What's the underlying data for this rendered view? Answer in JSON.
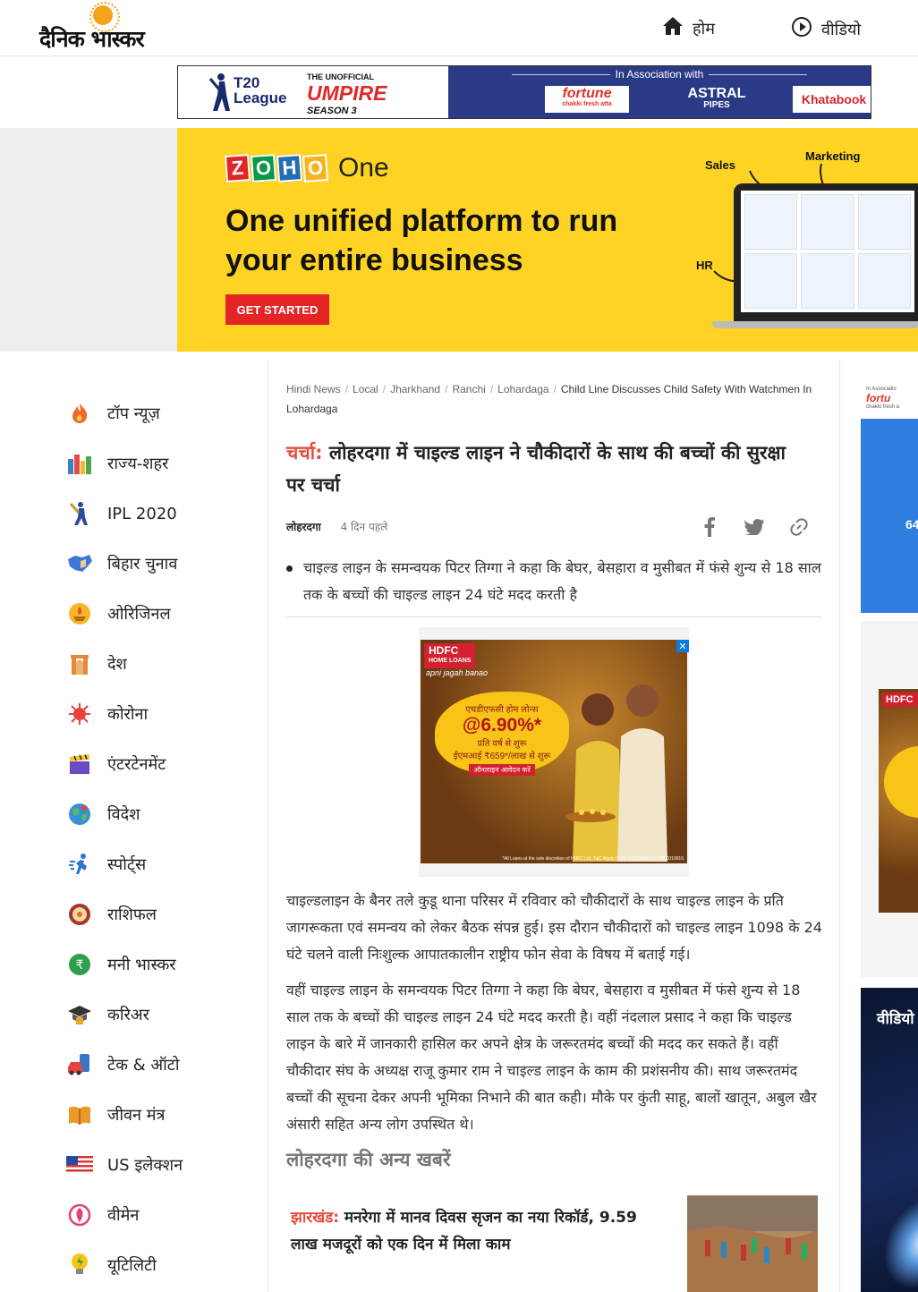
{
  "header": {
    "logo_text": "दैनिक भास्कर",
    "nav": [
      {
        "label": "होम",
        "icon": "home-icon"
      },
      {
        "label": "वीडियो",
        "icon": "play-circle-icon"
      }
    ]
  },
  "t20_banner": {
    "league": "T20\nLeague",
    "unofficial": "THE UNOFFICIAL",
    "umpire": "UMPIRE",
    "season": "SEASON 3",
    "association": "In Association with",
    "sponsors": [
      {
        "name": "fortune",
        "sub": "chakki fresh atta"
      },
      {
        "name": "ASTRAL",
        "sub": "PIPES"
      },
      {
        "name": "Khatabook"
      }
    ]
  },
  "zoho_ad": {
    "logo_letters": [
      "Z",
      "O",
      "H",
      "O"
    ],
    "logo_colors": [
      "#e42527",
      "#089949",
      "#226db4",
      "#f9b21d"
    ],
    "product": "One",
    "headline": "One unified platform to run your entire business",
    "cta": "GET STARTED",
    "labels": [
      "Sales",
      "Marketing",
      "HR"
    ]
  },
  "sidebar": {
    "items": [
      {
        "label": "टॉप न्यूज़",
        "icon": "fire-icon"
      },
      {
        "label": "राज्य-शहर",
        "icon": "city-icon"
      },
      {
        "label": "IPL 2020",
        "icon": "cricket-icon"
      },
      {
        "label": "बिहार चुनाव",
        "icon": "bihar-map-icon"
      },
      {
        "label": "ओरिजिनल",
        "icon": "lamp-icon"
      },
      {
        "label": "देश",
        "icon": "india-gate-icon"
      },
      {
        "label": "कोरोना",
        "icon": "virus-icon"
      },
      {
        "label": "एंटरटेनमेंट",
        "icon": "clapperboard-icon"
      },
      {
        "label": "विदेश",
        "icon": "globe-icon"
      },
      {
        "label": "स्पोर्ट्स",
        "icon": "runner-icon"
      },
      {
        "label": "राशिफल",
        "icon": "zodiac-icon"
      },
      {
        "label": "मनी भास्कर",
        "icon": "rupee-icon"
      },
      {
        "label": "करिअर",
        "icon": "graduation-cap-icon"
      },
      {
        "label": "टेक & ऑटो",
        "icon": "car-phone-icon"
      },
      {
        "label": "जीवन मंत्र",
        "icon": "book-icon"
      },
      {
        "label": "US इलेक्शन",
        "icon": "us-flag-icon"
      },
      {
        "label": "वीमेन",
        "icon": "women-icon"
      },
      {
        "label": "यूटिलिटी",
        "icon": "bulb-icon"
      }
    ]
  },
  "breadcrumb": {
    "items": [
      "Hindi News",
      "Local",
      "Jharkhand",
      "Ranchi",
      "Lohardaga"
    ],
    "current": "Child Line Discusses Child Safety With Watchmen In Lohardaga"
  },
  "article": {
    "kicker": "चर्चा:",
    "title": " लोहरदगा में चाइल्ड लाइन ने चौकीदारों के साथ की बच्चों की सुरक्षा पर चर्चा",
    "location": "लोहरदगा",
    "time": "4 दिन पहले",
    "summary": "चाइल्ड लाइन के समन्वयक पिटर तिग्गा ने कहा कि बेघर, बेसहारा व मुसीबत में फंसे शुन्य से 18 साल तक के बच्चों की चाइल्ड लाइन 24 घंटे मदद करती है",
    "para1": "चाइल्डलाइन के बैनर तले कुडू थाना परिसर में रविवार को चौकीदारों के साथ चाइल्ड लाइन के प्रति जागरूकता एवं समन्वय को लेकर बैठक संपन्न हुई। इस दौरान चौकीदारों को चाइल्ड लाइन 1098 के 24 घंटे चलने वाली निःशुल्क आपातकालीन राष्ट्रीय फोन सेवा के विषय में बताई गई।",
    "para2": "वहीं चाइल्ड लाइन के समन्वयक पिटर तिग्गा ने कहा कि बेघर, बेसहारा व मुसीबत में फंसे शुन्य से 18 साल तक के बच्चों की चाइल्ड लाइन 24 घंटे मदद करती है। वहीं नंदलाल प्रसाद ने कहा कि चाइल्ड लाइन के बारे में जानकारी हासिल कर अपने क्षेत्र के जरूरतमंद बच्चों की मदद कर सकते हैं। वहीं चौकीदार संघ के अध्यक्ष राजू कुमार राम ने चाइल्ड लाइन के काम की प्रशंसनीय की। साथ जरूरतमंद बच्चों की सूचना देकर अपनी भूमिका निभाने की बात कही। मौके पर कुंती साहू, बालों खातून, अबुल खैर अंसारी सहित अन्य लोग उपस्थित थे।"
  },
  "hdfc_ad": {
    "logo": "HDFC",
    "logo_sub": "HOME LOANS",
    "tagline": "apni jagah banao",
    "line1": "एचडीएफसी होम लोन्स",
    "rate": "@6.90%*",
    "line2": "प्रति वर्ष से शुरू",
    "line3": "ईएमआई ₹659*/लाख से शुरू",
    "apply": "ऑनलाइन आवेदन करें",
    "close": "✕",
    "fine": "*All Loans at the sole discretion of HDFC Ltd. T&C Apply | CIN: L70100MH1977PLC019916"
  },
  "more_news": {
    "title": "लोहरदगा की अन्य खबरें",
    "stories": [
      {
        "kicker": "झारखंड:",
        "title": " मनरेगा में मानव दिवस सृजन का नया रिकॉर्ड, 9.59 लाख मजदूरों को एक दिन में मिला काम"
      }
    ]
  },
  "right_rail": {
    "ad1_top": "In Associatio",
    "ad1_brand": "fortu",
    "ad1_sub": "chakki fresh a",
    "ad1_num": "64",
    "ad2_logo": "HDFC",
    "video_title": "वीडियो"
  },
  "colors": {
    "accent": "#e64b3c",
    "zoho_yellow": "#fed324",
    "cta_red": "#e42527",
    "t20_blue": "#2a3a86"
  }
}
